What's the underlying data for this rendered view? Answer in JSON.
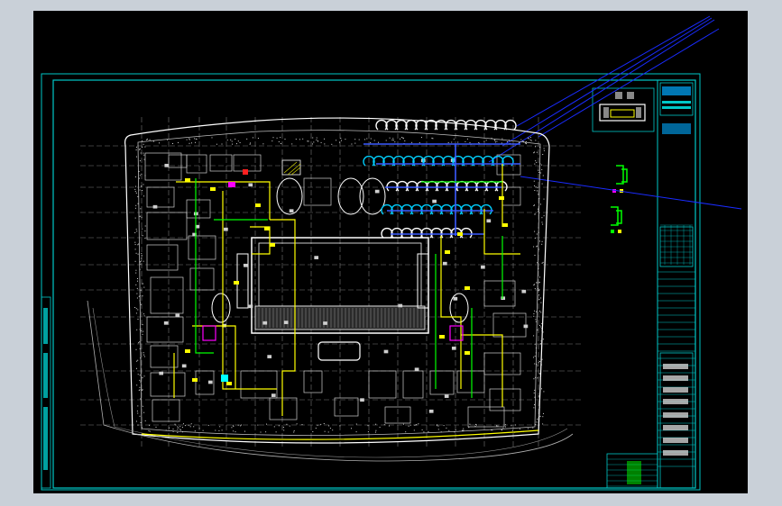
{
  "app": {
    "viewport_background": "#000000",
    "frame_background": "#c9d0d8"
  },
  "drawing": {
    "type": "CAD floor plan (HVAC / piping layout)",
    "colors": {
      "frame": "#00c8c8",
      "walls": "#ffffff",
      "grid": "#8a8a8a",
      "piping_yellow": "#ffff00",
      "piping_green": "#00ff00",
      "duct_blue": "#3b5bff",
      "duct_cyan": "#00d0ff",
      "pipe_blue_line": "#1a2cff",
      "equipment_magenta": "#ff00ff",
      "accent_red": "#ff2020"
    },
    "title_block": {
      "logo_text": "",
      "rows": 28
    },
    "detail_symbols": [
      {
        "name": "detail-symbol-1",
        "color": "#00ff00"
      },
      {
        "name": "detail-symbol-2",
        "color": "#00ff00"
      }
    ]
  }
}
